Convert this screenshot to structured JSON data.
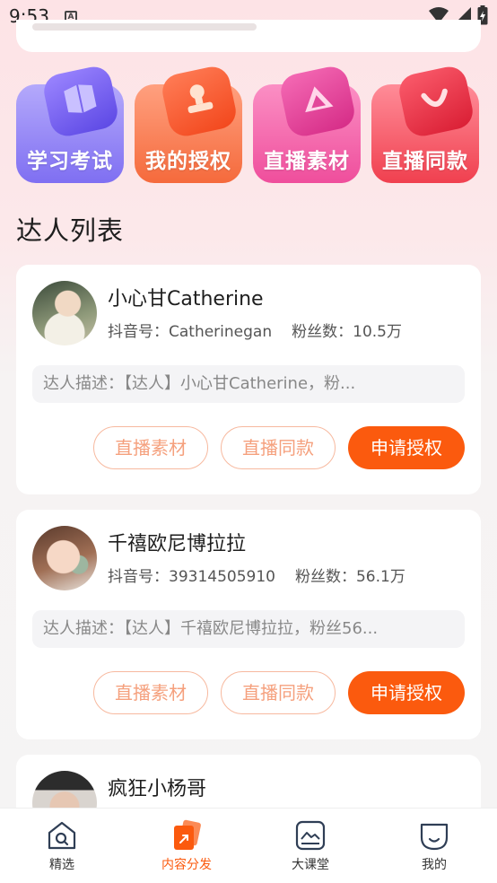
{
  "status_bar": {
    "time": "9:53",
    "notification_badge": "A"
  },
  "features": [
    {
      "label": "学习考试",
      "icon": "book-icon",
      "color": "#8a7cf3"
    },
    {
      "label": "我的授权",
      "icon": "stamp-icon",
      "color": "#f7764a"
    },
    {
      "label": "直播素材",
      "icon": "triangle-icon",
      "color": "#f45aa7"
    },
    {
      "label": "直播同款",
      "icon": "smile-icon",
      "color": "#f5475d"
    }
  ],
  "section_title": "达人列表",
  "influencers": [
    {
      "name": "小心甘Catherine",
      "douyin_label": "抖音号：",
      "douyin_id": "Catherinegan",
      "fans_label": "粉丝数：",
      "fans": "10.5万",
      "description": "达人描述：【达人】小心甘Catherine，粉...",
      "btn_material": "直播素材",
      "btn_same": "直播同款",
      "btn_apply": "申请授权"
    },
    {
      "name": "千禧欧尼博拉拉",
      "douyin_label": "抖音号：",
      "douyin_id": "39314505910",
      "fans_label": "粉丝数：",
      "fans": "56.1万",
      "description": "达人描述：【达人】千禧欧尼博拉拉，粉丝56...",
      "btn_material": "直播素材",
      "btn_same": "直播同款",
      "btn_apply": "申请授权"
    },
    {
      "name": "疯狂小杨哥"
    }
  ],
  "bottom_nav": [
    {
      "label": "精选",
      "icon": "home-search-icon",
      "active": false
    },
    {
      "label": "内容分发",
      "icon": "content-distribute-icon",
      "active": true
    },
    {
      "label": "大课堂",
      "icon": "classroom-icon",
      "active": false
    },
    {
      "label": "我的",
      "icon": "profile-icon",
      "active": false
    }
  ],
  "accent_color": "#fb5a0e"
}
